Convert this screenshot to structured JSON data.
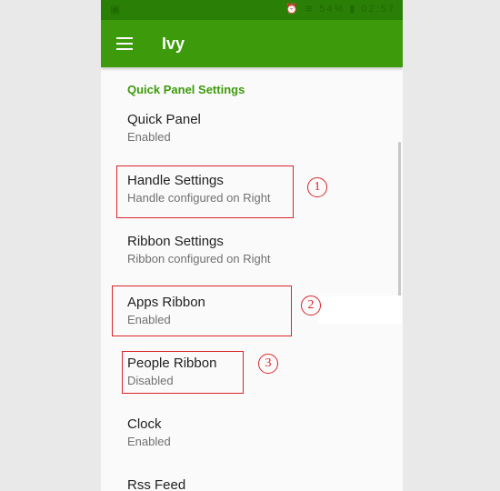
{
  "app": {
    "title": "Ivy"
  },
  "status_bar": {
    "time": "02:57",
    "battery": "54%"
  },
  "section": {
    "header": "Quick Panel Settings"
  },
  "preferences": [
    {
      "title": "Quick Panel",
      "summary": "Enabled"
    },
    {
      "title": "Handle Settings",
      "summary": "Handle configured on Right"
    },
    {
      "title": "Ribbon Settings",
      "summary": "Ribbon configured on Right"
    },
    {
      "title": "Apps Ribbon",
      "summary": "Enabled"
    },
    {
      "title": "People Ribbon",
      "summary": "Disabled"
    },
    {
      "title": "Clock",
      "summary": "Enabled"
    },
    {
      "title": "Rss Feed",
      "summary": ""
    }
  ],
  "annotations": [
    "1",
    "2",
    "3"
  ],
  "colors": {
    "toolbar": "#3d9b0b",
    "status_bar": "#2a7f06",
    "accent": "#3d9b0b",
    "annotation": "#d9252b"
  }
}
